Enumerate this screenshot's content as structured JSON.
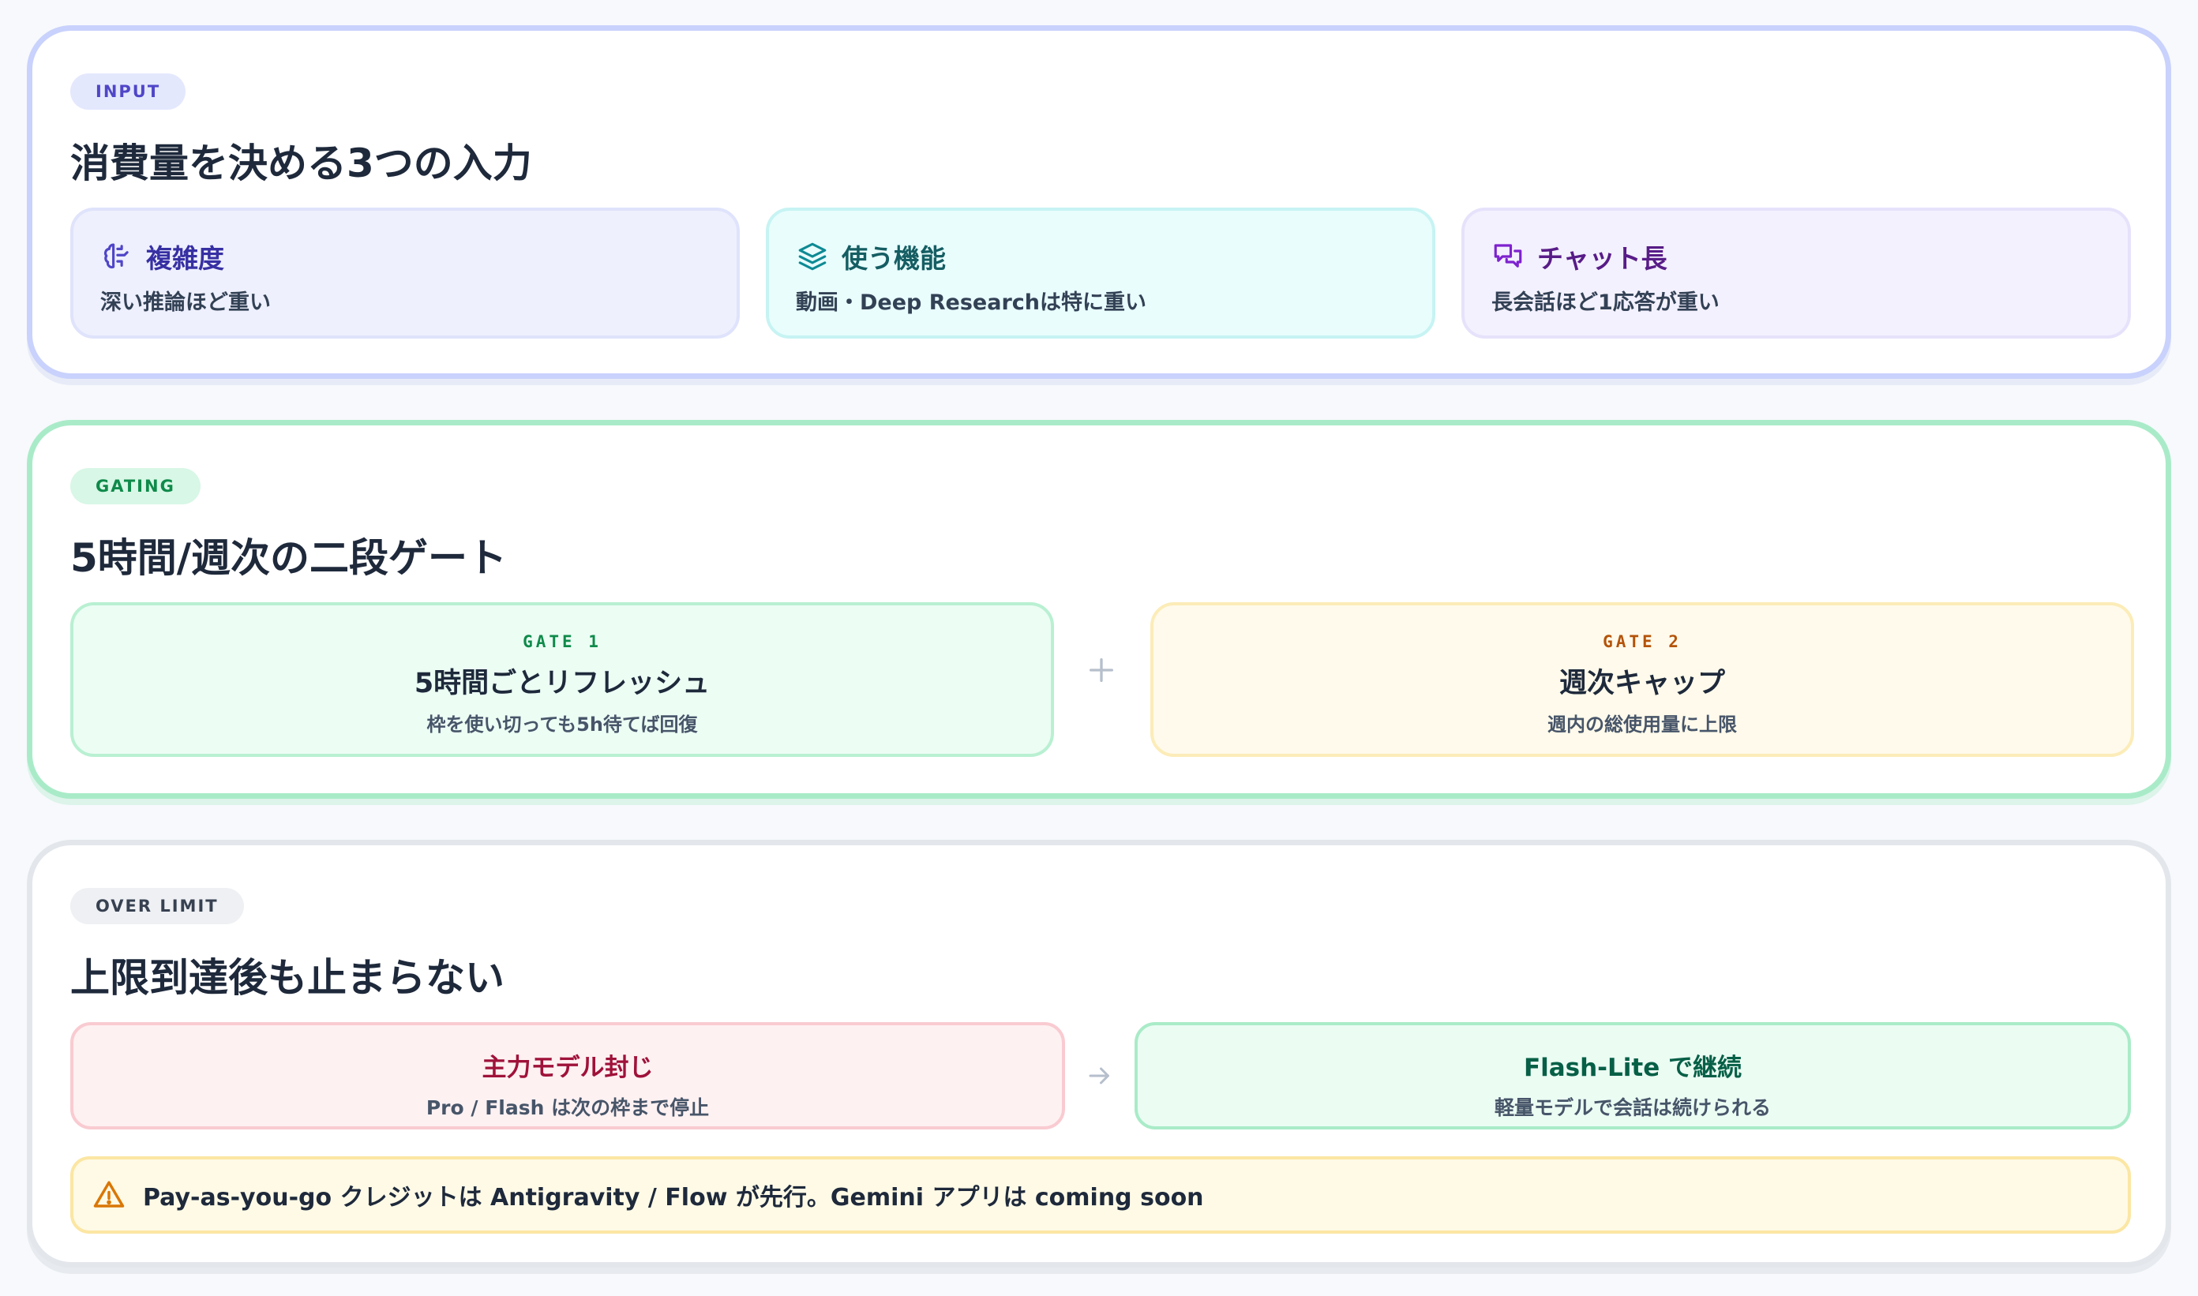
{
  "input": {
    "badge": "INPUT",
    "title": "消費量を決める3つの入力",
    "cards": [
      {
        "label": "複雑度",
        "desc": "深い推論ほど重い",
        "icon": "brain-icon"
      },
      {
        "label": "使う機能",
        "desc": "動画・Deep Researchは特に重い",
        "icon": "layers-icon"
      },
      {
        "label": "チャット長",
        "desc": "長会話ほど1応答が重い",
        "icon": "chat-bubbles-icon"
      }
    ]
  },
  "gating": {
    "badge": "GATING",
    "title": "5時間/週次の二段ゲート",
    "gates": [
      {
        "tag": "GATE 1",
        "name": "5時間ごとリフレッシュ",
        "desc": "枠を使い切っても5h待てば回復"
      },
      {
        "tag": "GATE 2",
        "name": "週次キャップ",
        "desc": "週内の総使用量に上限"
      }
    ],
    "connector": "plus-icon"
  },
  "over_limit": {
    "badge": "OVER LIMIT",
    "title": "上限到達後も止まらない",
    "before": {
      "name": "主力モデル封じ",
      "desc": "Pro / Flash は次の枠まで停止"
    },
    "after": {
      "name": "Flash-Lite で継続",
      "desc": "軽量モデルで会話は続けられる"
    },
    "connector": "arrow-right-icon",
    "notice": "Pay-as-you-go クレジットは Antigravity / Flow が先行。Gemini アプリは coming soon"
  },
  "colors": {
    "input_accent": "#4f46c8",
    "gating_accent": "#0f8a4a",
    "gate2_accent": "#b45309",
    "blocked_accent": "#9f1239",
    "continue_accent": "#065f46",
    "warning_accent": "#d97706"
  }
}
